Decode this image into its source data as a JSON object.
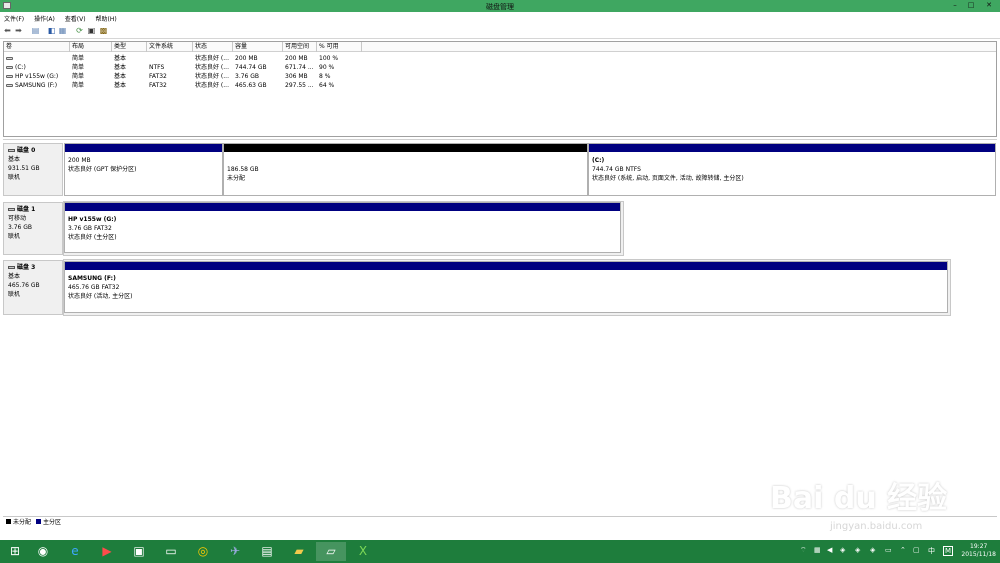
{
  "window": {
    "title": "磁盘管理",
    "minimize": "–",
    "maximize": "□",
    "close": "✕"
  },
  "menu": [
    "文件(F)",
    "操作(A)",
    "查看(V)",
    "帮助(H)"
  ],
  "volume_table": {
    "headers": [
      "卷",
      "布局",
      "类型",
      "文件系统",
      "状态",
      "容量",
      "可用空间",
      "% 可用"
    ],
    "rows": [
      [
        "",
        "简单",
        "基本",
        "",
        "状态良好 (...",
        "200 MB",
        "200 MB",
        "100 %"
      ],
      [
        "(C:)",
        "简单",
        "基本",
        "NTFS",
        "状态良好 (...",
        "744.74 GB",
        "671.74 ...",
        "90 %"
      ],
      [
        "HP v155w (G:)",
        "简单",
        "基本",
        "FAT32",
        "状态良好 (...",
        "3.76 GB",
        "306 MB",
        "8 %"
      ],
      [
        "SAMSUNG (F:)",
        "简单",
        "基本",
        "FAT32",
        "状态良好 (...",
        "465.63 GB",
        "297.55 ...",
        "64 %"
      ]
    ]
  },
  "disks": [
    {
      "name": "磁盘 0",
      "type": "基本",
      "size": "931.51 GB",
      "status": "联机",
      "partitions": [
        {
          "title": "",
          "size": "200 MB",
          "status": "状态良好 (GPT 保护分区)",
          "bar": "#000080"
        },
        {
          "title": "",
          "size": "186.58 GB",
          "status": "未分配",
          "bar": "#000000"
        },
        {
          "title": "(C:)",
          "size": "744.74 GB NTFS",
          "status": "状态良好 (系统, 启动, 页面文件, 活动, 故障转储, 主分区)",
          "bar": "#000080"
        }
      ]
    },
    {
      "name": "磁盘 1",
      "type": "可移动",
      "size": "3.76 GB",
      "status": "联机",
      "partitions": [
        {
          "title": "HP v155w  (G:)",
          "size": "3.76 GB FAT32",
          "status": "状态良好 (主分区)",
          "bar": "#000080"
        }
      ]
    },
    {
      "name": "磁盘 3",
      "type": "基本",
      "size": "465.76 GB",
      "status": "联机",
      "partitions": [
        {
          "title": "SAMSUNG  (F:)",
          "size": "465.76 GB FAT32",
          "status": "状态良好 (活动, 主分区)",
          "bar": "#000080"
        }
      ]
    }
  ],
  "legend": [
    {
      "label": "未分配",
      "color": "#000000"
    },
    {
      "label": "主分区",
      "color": "#000080"
    }
  ],
  "taskbar": {
    "clock_time": "19:27",
    "clock_date": "2015/11/18",
    "ime": "中",
    "ime2": "M"
  },
  "watermark": {
    "brand": "Bai du 经验",
    "url": "jingyan.baidu.com"
  },
  "colors": {
    "titlebar": "#3fa761",
    "taskbar": "#1e7d3c",
    "primary_partition": "#000080",
    "unallocated": "#000000"
  }
}
